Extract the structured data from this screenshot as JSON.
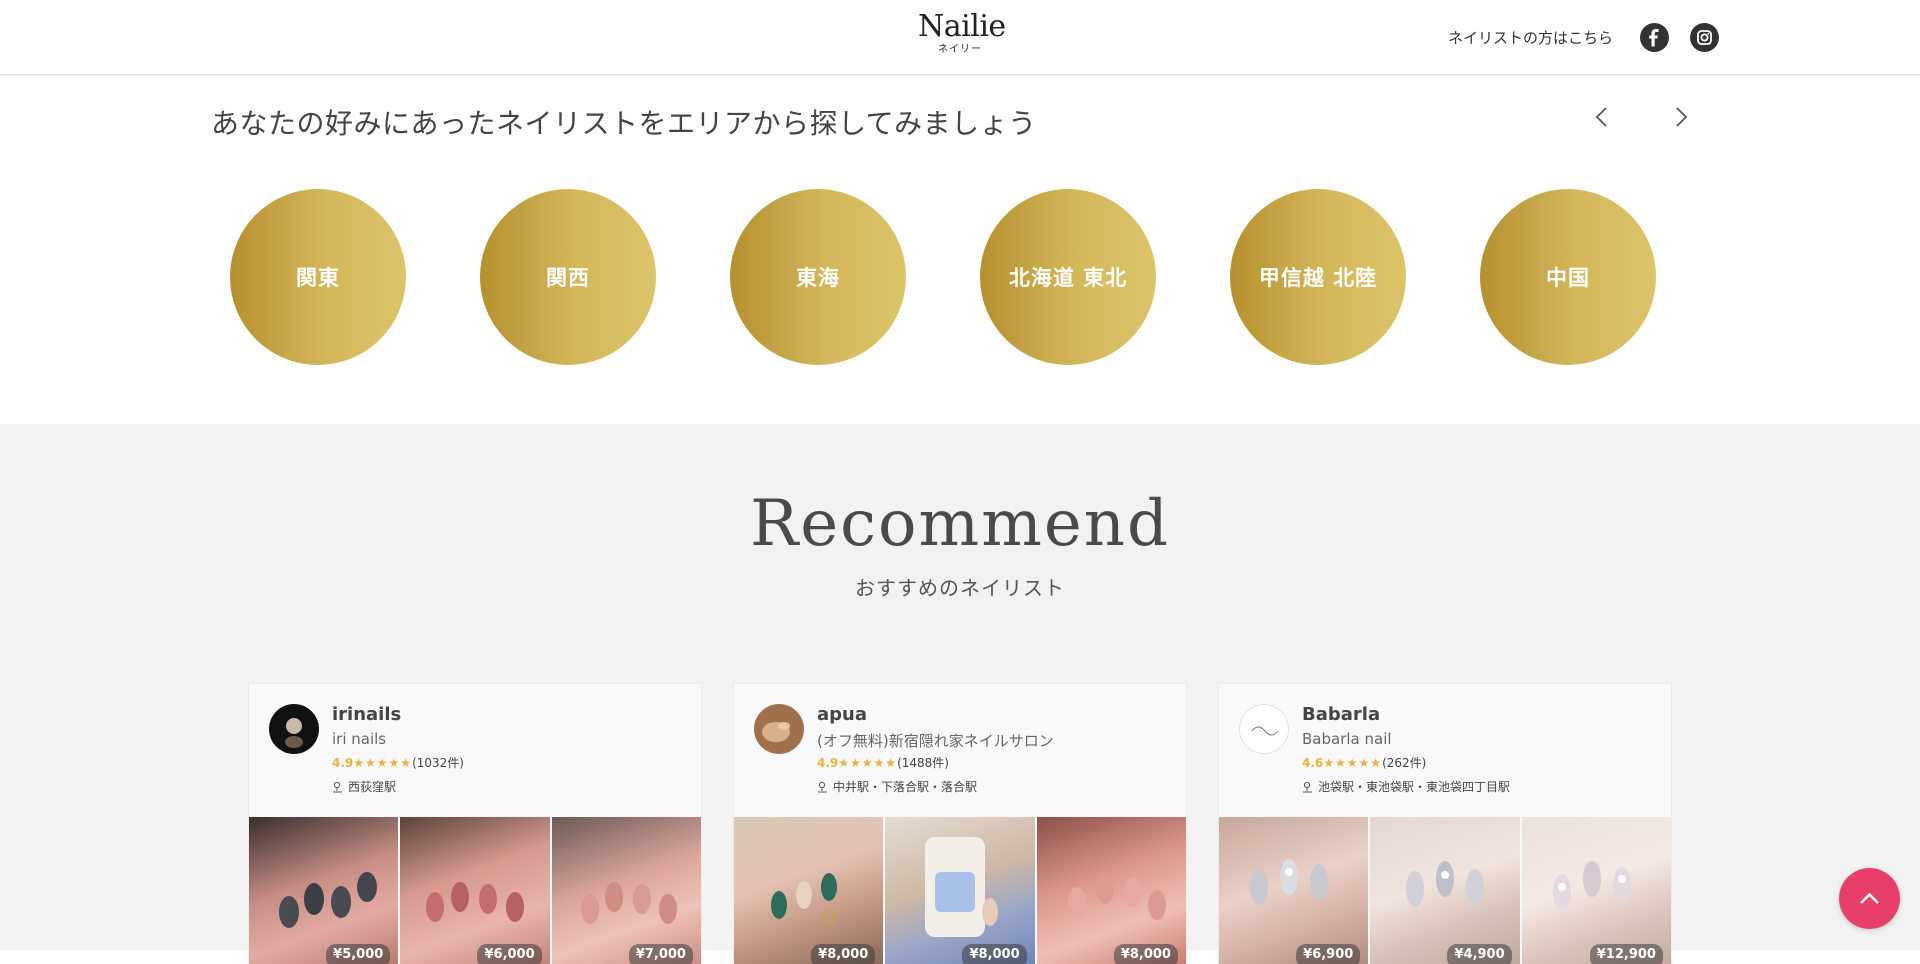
{
  "header": {
    "logo": "Nailie",
    "logo_sub": "ネイリー",
    "nailist_link": "ネイリストの方はこちら",
    "icons": [
      "facebook-icon",
      "instagram-icon"
    ]
  },
  "area": {
    "title": "あなたの好みにあったネイリストをエリアから探してみましょう",
    "items": [
      "関東",
      "関西",
      "東海",
      "北海道 東北",
      "甲信越 北陸",
      "中国"
    ]
  },
  "recommend": {
    "title": "Recommend",
    "subtitle": "おすすめのネイリスト",
    "cards": [
      {
        "name": "irinails",
        "salon": "iri nails",
        "score": "4.9",
        "stars": "★★★★★",
        "count": "(1032件)",
        "station": "西荻窪駅",
        "prices": [
          "¥5,000",
          "¥6,000",
          "¥7,000"
        ]
      },
      {
        "name": "apua",
        "salon": "(オフ無料)新宿隠れ家ネイルサロン",
        "score": "4.9",
        "stars": "★★★★★",
        "count": "(1488件)",
        "station": "中井駅・下落合駅・落合駅",
        "prices": [
          "¥8,000",
          "¥8,000",
          "¥8,000"
        ]
      },
      {
        "name": "Babarla",
        "salon": "Babarla nail",
        "score": "4.6",
        "stars": "★★★★★",
        "count": "(262件)",
        "station": "池袋駅・東池袋駅・東池袋四丁目駅",
        "prices": [
          "¥6,900",
          "¥4,900",
          "¥12,900"
        ]
      }
    ]
  },
  "colors": {
    "gold_start": "#b5902f",
    "gold_end": "#dcc46a",
    "accent_pink": "#e83e6a",
    "star": "#e8b33d"
  }
}
